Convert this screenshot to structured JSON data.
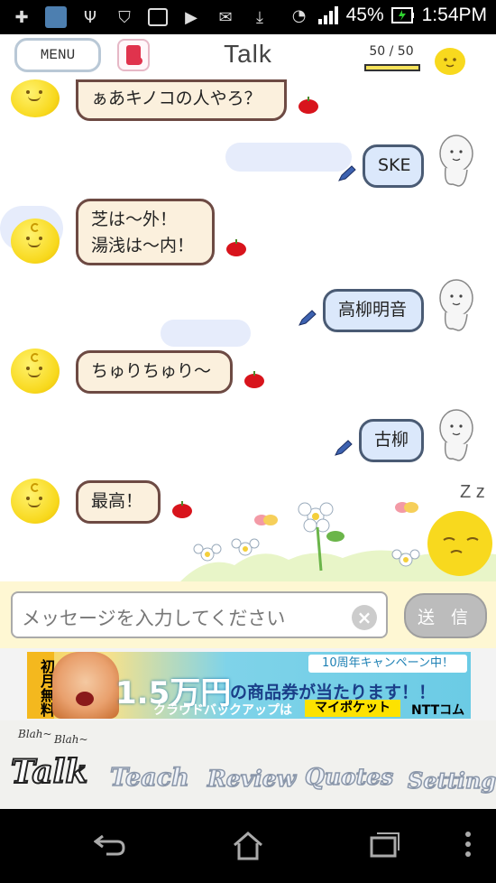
{
  "status_bar": {
    "battery": "45%",
    "time": "1:54PM",
    "left_icons": [
      "add-icon",
      "app-icon",
      "usb-icon",
      "mcafee-icon",
      "image-icon",
      "play-icon",
      "mail-icon",
      "download-icon"
    ],
    "right_icons": [
      "wifi-icon",
      "signal-icon",
      "battery-icon"
    ]
  },
  "header": {
    "menu_label": "MENU",
    "title": "Talk",
    "counter": "50 / 50",
    "counter_fraction": 1.0
  },
  "messages": [
    {
      "from": "bot",
      "text": "ぁあキノコの人やろ？"
    },
    {
      "from": "user",
      "text": "SKE"
    },
    {
      "from": "bot",
      "text": "芝は～外！\n湯浅は～内！"
    },
    {
      "from": "user",
      "text": "高柳明音"
    },
    {
      "from": "bot",
      "text": "ちゅりちゅり～"
    },
    {
      "from": "user",
      "text": "古柳"
    },
    {
      "from": "bot",
      "text": "最高！"
    }
  ],
  "decoration": {
    "sleep_text": "Z z"
  },
  "input": {
    "placeholder": "メッセージを入力してください",
    "send_label": "送 信"
  },
  "ad": {
    "badge": "初月無料",
    "tag": "10周年キャンペーン中！",
    "big": "1.5万円",
    "line": "の商品券が当たります！！",
    "sub": "クラウドバックアップは",
    "pocket": "マイポケット",
    "ntt": "NTTコム"
  },
  "tabs": {
    "blah1": "Blah~",
    "blah2": "Blah~",
    "items": [
      "Talk",
      "Teach",
      "Review",
      "Quotes",
      "Setting"
    ],
    "active": "Talk"
  },
  "colors": {
    "bot_bubble": "#fbf0dd",
    "user_bubble": "#dbe8fb",
    "input_bar_bg": "#fef7d3"
  }
}
